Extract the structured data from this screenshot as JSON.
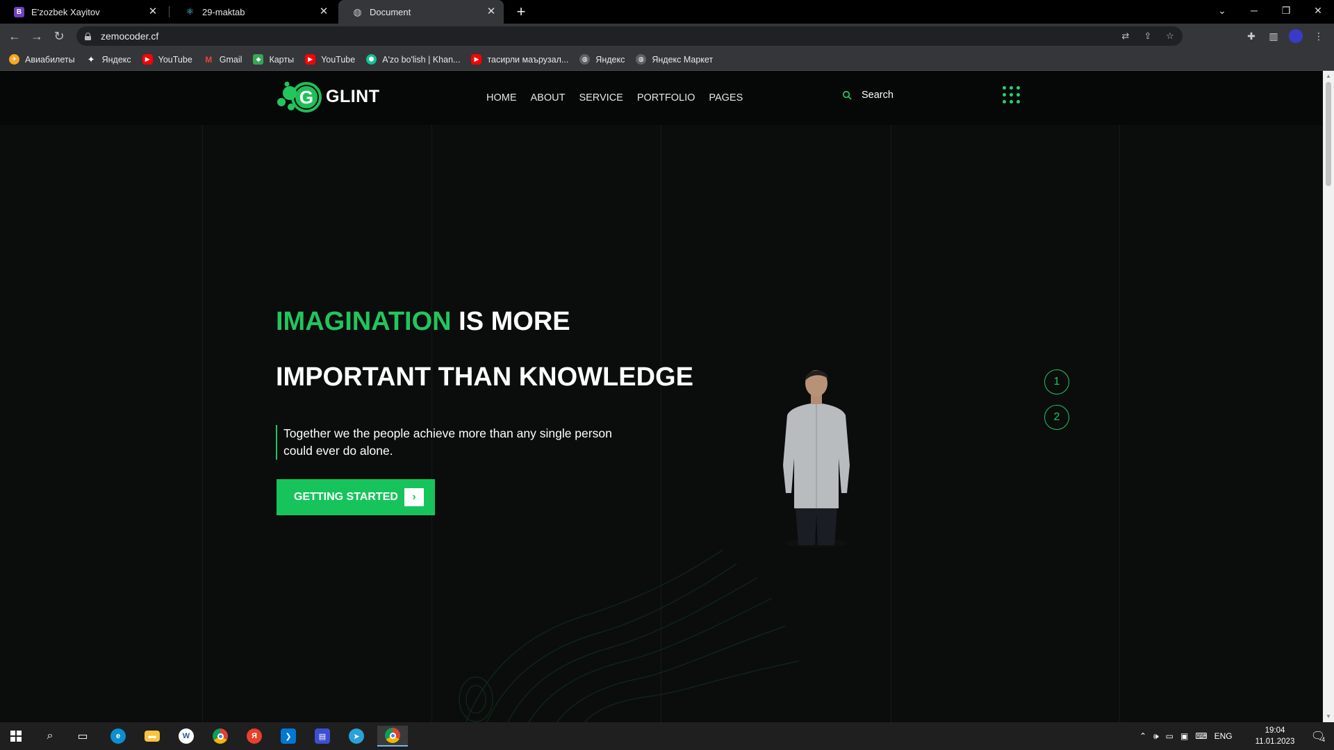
{
  "browser": {
    "tabs": [
      {
        "title": "E'zozbek Xayitov",
        "favicon": "bootstrap-icon",
        "color": "#6f42c1",
        "glyph": "B",
        "active": false
      },
      {
        "title": "29-maktab",
        "favicon": "react-icon",
        "color": "#61dafb",
        "glyph": "⚛",
        "active": false
      },
      {
        "title": "Document",
        "favicon": "globe-icon",
        "color": "#9aa0a6",
        "glyph": "◍",
        "active": true
      }
    ],
    "url": "zemocoder.cf",
    "bookmarks": [
      {
        "label": "Авиабилеты",
        "icon": "avia-icon",
        "color": "#f5a623",
        "glyph": "✈"
      },
      {
        "label": "Яндекс",
        "icon": "yandex-spark-icon",
        "color": "#35363a",
        "glyph": "✦"
      },
      {
        "label": "YouTube",
        "icon": "youtube-icon",
        "color": "#ff0000",
        "glyph": "▶"
      },
      {
        "label": "Gmail",
        "icon": "gmail-icon",
        "color": "#d93025",
        "glyph": "M"
      },
      {
        "label": "Карты",
        "icon": "maps-icon",
        "color": "#34a853",
        "glyph": "◆"
      },
      {
        "label": "YouTube",
        "icon": "youtube-icon",
        "color": "#ff0000",
        "glyph": "▶"
      },
      {
        "label": "A'zo bo'lish | Khan...",
        "icon": "khan-icon",
        "color": "#14bf96",
        "glyph": "⬢"
      },
      {
        "label": "тасирли маърузал...",
        "icon": "youtube-icon",
        "color": "#ff0000",
        "glyph": "▶"
      },
      {
        "label": "Яндекс",
        "icon": "globe-icon",
        "color": "#5f6368",
        "glyph": "◍"
      },
      {
        "label": "Яндекс Маркет",
        "icon": "globe-icon",
        "color": "#5f6368",
        "glyph": "◍"
      }
    ]
  },
  "site": {
    "logo_text": "GLINT",
    "nav": [
      "HOME",
      "ABOUT",
      "SERVICE",
      "PORTFOLIO",
      "PAGES"
    ],
    "search_placeholder": "Search",
    "hero": {
      "title_accent": "IMAGINATION",
      "title_rest": " IS MORE",
      "title_line2": "IMPORTANT THAN KNOWLEDGE",
      "quote": "Together we the people achieve more than any single person could ever do alone.",
      "cta_label": "GETTING STARTED"
    },
    "slider": [
      "1",
      "2"
    ],
    "accent_color": "#22c55e"
  },
  "taskbar": {
    "apps": [
      {
        "name": "start-button",
        "glyph": "⊞"
      },
      {
        "name": "search-button",
        "glyph": "⌕"
      },
      {
        "name": "task-view-button",
        "glyph": "▭"
      },
      {
        "name": "edge-icon",
        "color": "#0c8fd1",
        "glyph": "e"
      },
      {
        "name": "file-explorer-icon",
        "color": "#f8c440",
        "glyph": "▬"
      },
      {
        "name": "word-icon",
        "color": "#2b579a",
        "glyph": "W"
      },
      {
        "name": "chrome-icon",
        "color": "#db4437",
        "glyph": "◉"
      },
      {
        "name": "yandex-browser-icon",
        "color": "#e8402c",
        "glyph": "Я"
      },
      {
        "name": "vscode-icon",
        "color": "#0078d4",
        "glyph": "❯"
      },
      {
        "name": "save-app-icon",
        "color": "#3d4fd1",
        "glyph": "▤"
      },
      {
        "name": "telegram-icon",
        "color": "#2aa1da",
        "glyph": "➤"
      },
      {
        "name": "chrome-active-icon",
        "color": "#db4437",
        "glyph": "◉"
      }
    ],
    "language": "ENG",
    "time": "19:04",
    "date": "11.01.2023",
    "notification_count": "4"
  }
}
